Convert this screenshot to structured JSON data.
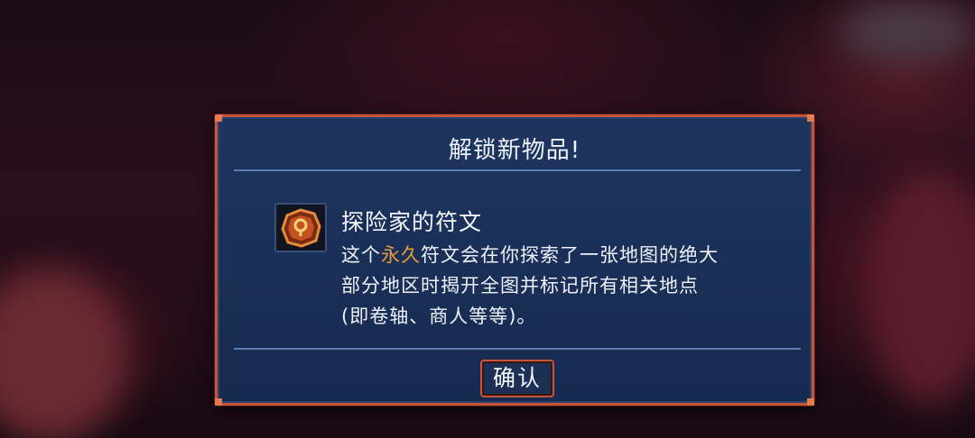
{
  "dialog": {
    "title": "解锁新物品!",
    "item": {
      "icon": "explorer-rune-icon",
      "name": "探险家的符文",
      "desc_before": "这个",
      "desc_highlight": "永久",
      "desc_line1_after": "符文会在你探索了一张地图的绝大",
      "desc_line2": "部分地区时揭开全图并标记所有相关地点",
      "desc_line3": "(即卷轴、商人等等)。"
    },
    "confirm_label": "确认"
  },
  "colors": {
    "border": "#c4553a",
    "panel": "#1b3058",
    "highlight": "#e79a3d",
    "text": "#eef1f8"
  }
}
